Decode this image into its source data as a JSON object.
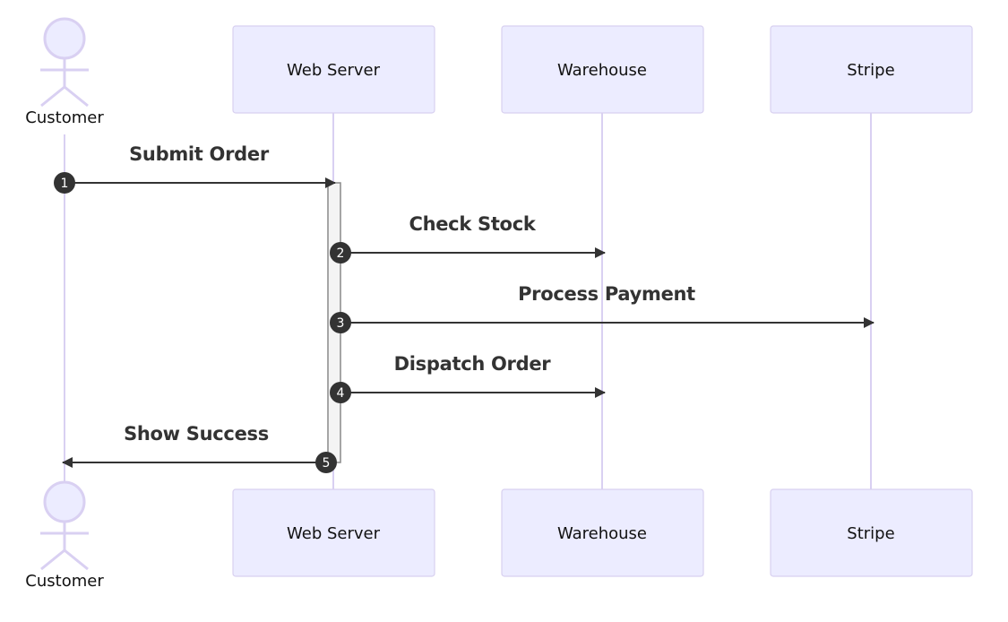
{
  "participants": [
    {
      "id": "customer",
      "label": "Customer",
      "type": "actor"
    },
    {
      "id": "web_server",
      "label": "Web Server",
      "type": "participant"
    },
    {
      "id": "warehouse",
      "label": "Warehouse",
      "type": "participant"
    },
    {
      "id": "stripe",
      "label": "Stripe",
      "type": "participant"
    }
  ],
  "messages": [
    {
      "seq": "1",
      "from": "customer",
      "to": "web_server",
      "label": "Submit Order"
    },
    {
      "seq": "2",
      "from": "web_server",
      "to": "warehouse",
      "label": "Check Stock"
    },
    {
      "seq": "3",
      "from": "web_server",
      "to": "stripe",
      "label": "Process Payment"
    },
    {
      "seq": "4",
      "from": "web_server",
      "to": "warehouse",
      "label": "Dispatch Order"
    },
    {
      "seq": "5",
      "from": "web_server",
      "to": "customer",
      "label": "Show Success"
    }
  ],
  "activations": [
    {
      "participant": "web_server",
      "from_message": 1,
      "to_message": 5
    }
  ],
  "colors": {
    "actor_fill": "#ECECFF",
    "actor_stroke": "#D9D0F2",
    "message": "#333333",
    "activation_fill": "#F4F4F4"
  }
}
